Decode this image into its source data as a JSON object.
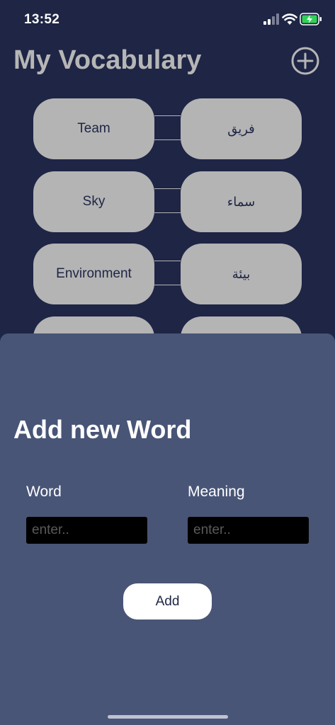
{
  "status_bar": {
    "time": "13:52",
    "icons": [
      "signal-icon",
      "wifi-icon",
      "battery-icon"
    ]
  },
  "header": {
    "title": "My Vocabulary",
    "add_icon": "plus-circle-icon"
  },
  "vocabulary": [
    {
      "word": "Team",
      "meaning": "فريق"
    },
    {
      "word": "Sky",
      "meaning": "سماء"
    },
    {
      "word": "Environment",
      "meaning": "بيئة"
    },
    {
      "word": "",
      "meaning": ""
    }
  ],
  "add_sheet": {
    "title": "Add new Word",
    "word_label": "Word",
    "word_placeholder": "enter..",
    "word_value": "",
    "meaning_label": "Meaning",
    "meaning_placeholder": "enter..",
    "meaning_value": "",
    "add_button_label": "Add"
  },
  "colors": {
    "background": "#1e2545",
    "pill": "#b4b4b4",
    "sheet": "#485577",
    "title": "#b6b6b6",
    "input_bg": "#000000",
    "button_bg": "#ffffff"
  }
}
